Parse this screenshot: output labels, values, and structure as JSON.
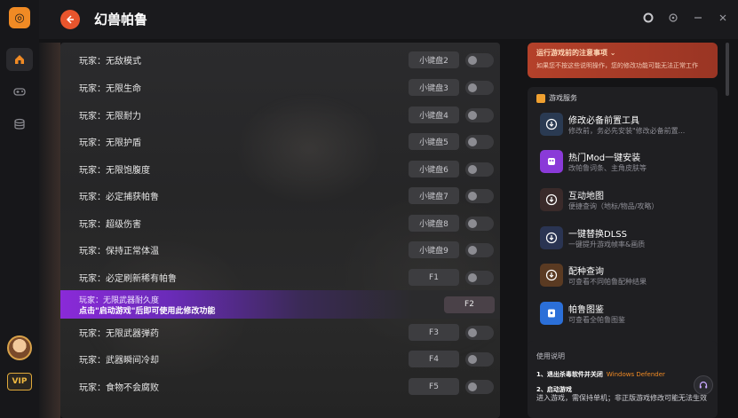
{
  "window": {
    "title": "幻兽帕鲁",
    "logo_glyph": "◎",
    "accent": "#e8552d",
    "brand": "#f08a24"
  },
  "rail": {
    "vip_label": "VIP"
  },
  "rows": [
    {
      "label": "玩家：无敌模式",
      "key": "小键盘2"
    },
    {
      "label": "玩家：无限生命",
      "key": "小键盘3"
    },
    {
      "label": "玩家：无限耐力",
      "key": "小键盘4"
    },
    {
      "label": "玩家：无限护盾",
      "key": "小键盘5"
    },
    {
      "label": "玩家：无限饱腹度",
      "key": "小键盘6"
    },
    {
      "label": "玩家：必定捕获帕鲁",
      "key": "小键盘7"
    },
    {
      "label": "玩家：超级伤害",
      "key": "小键盘8"
    },
    {
      "label": "玩家：保持正常体温",
      "key": "小键盘9"
    },
    {
      "label": "玩家：必定刷新稀有帕鲁",
      "key": "F1"
    },
    {
      "label": "玩家：无限武器耐久度",
      "key": "F2",
      "hint": "点击\"启动游戏\"后即可使用此修改功能"
    },
    {
      "label": "玩家：无限武器弹药",
      "key": "F3"
    },
    {
      "label": "玩家：武器瞬间冷却",
      "key": "F4"
    },
    {
      "label": "玩家：食物不会腐败",
      "key": "F5"
    }
  ],
  "notice": {
    "title": "运行游戏前的注意事项",
    "desc": "如果您不按这些说明操作，您的修改功能可能无法正常工作"
  },
  "services": {
    "header": "游戏服务",
    "items": [
      {
        "name": "修改必备前置工具",
        "desc": "修改前，务必先安装\"修改必备前置...",
        "color": "#2a3a52",
        "icon": "download-icon"
      },
      {
        "name": "热门Mod一键安装",
        "desc": "改帕鲁词条、主角皮肤等",
        "color": "#8a3ad8",
        "icon": "mod-icon"
      },
      {
        "name": "互动地图",
        "desc": "便捷查询（地标/物品/攻略）",
        "color": "#3a2a2a",
        "icon": "map-icon"
      },
      {
        "name": "一键替换DLSS",
        "desc": "一键提升游戏帧率&画质",
        "color": "#2a3452",
        "icon": "dlss-icon"
      },
      {
        "name": "配种查询",
        "desc": "可查看不同帕鲁配种结果",
        "color": "#5a3a22",
        "icon": "breed-icon"
      },
      {
        "name": "帕鲁图鉴",
        "desc": "可查看全帕鲁图鉴",
        "color": "#2b6fd8",
        "icon": "book-icon"
      }
    ]
  },
  "guide": {
    "header": "使用说明",
    "step1": "1、退出杀毒软件并关闭",
    "step1_hl": "Windows Defender",
    "step2": "2、启动游戏",
    "step2_desc": "进入游戏，需保持单机；非正版游戏修改可能无法生效"
  }
}
